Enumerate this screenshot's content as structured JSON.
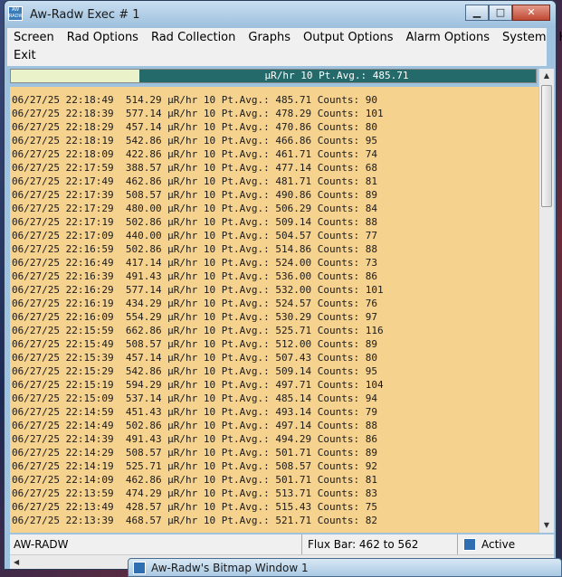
{
  "window": {
    "title": "Aw-Radw Exec # 1",
    "app_icon_text": "AW RADW",
    "buttons": {
      "minimize": "▁",
      "maximize": "□",
      "close": "✕"
    }
  },
  "menu": {
    "row1": [
      "Screen",
      "Rad Options",
      "Rad Collection",
      "Graphs",
      "Output Options",
      "Alarm Options",
      "System",
      "Help"
    ],
    "row2": [
      "Exit"
    ]
  },
  "gauge": {
    "text": "µR/hr 10 Pt.Avg.: 485.71",
    "fill_fraction": 0.755,
    "fill_color": "#246a6a",
    "track_color": "#e9f2c8"
  },
  "log": {
    "background": "#f6d28f",
    "rows": [
      "06/27/25 22:18:49  514.29 µR/hr 10 Pt.Avg.: 485.71 Counts: 90",
      "06/27/25 22:18:39  577.14 µR/hr 10 Pt.Avg.: 478.29 Counts: 101",
      "06/27/25 22:18:29  457.14 µR/hr 10 Pt.Avg.: 470.86 Counts: 80",
      "06/27/25 22:18:19  542.86 µR/hr 10 Pt.Avg.: 466.86 Counts: 95",
      "06/27/25 22:18:09  422.86 µR/hr 10 Pt.Avg.: 461.71 Counts: 74",
      "06/27/25 22:17:59  388.57 µR/hr 10 Pt.Avg.: 477.14 Counts: 68",
      "06/27/25 22:17:49  462.86 µR/hr 10 Pt.Avg.: 481.71 Counts: 81",
      "06/27/25 22:17:39  508.57 µR/hr 10 Pt.Avg.: 490.86 Counts: 89",
      "06/27/25 22:17:29  480.00 µR/hr 10 Pt.Avg.: 506.29 Counts: 84",
      "06/27/25 22:17:19  502.86 µR/hr 10 Pt.Avg.: 509.14 Counts: 88",
      "06/27/25 22:17:09  440.00 µR/hr 10 Pt.Avg.: 504.57 Counts: 77",
      "06/27/25 22:16:59  502.86 µR/hr 10 Pt.Avg.: 514.86 Counts: 88",
      "06/27/25 22:16:49  417.14 µR/hr 10 Pt.Avg.: 524.00 Counts: 73",
      "06/27/25 22:16:39  491.43 µR/hr 10 Pt.Avg.: 536.00 Counts: 86",
      "06/27/25 22:16:29  577.14 µR/hr 10 Pt.Avg.: 532.00 Counts: 101",
      "06/27/25 22:16:19  434.29 µR/hr 10 Pt.Avg.: 524.57 Counts: 76",
      "06/27/25 22:16:09  554.29 µR/hr 10 Pt.Avg.: 530.29 Counts: 97",
      "06/27/25 22:15:59  662.86 µR/hr 10 Pt.Avg.: 525.71 Counts: 116",
      "06/27/25 22:15:49  508.57 µR/hr 10 Pt.Avg.: 512.00 Counts: 89",
      "06/27/25 22:15:39  457.14 µR/hr 10 Pt.Avg.: 507.43 Counts: 80",
      "06/27/25 22:15:29  542.86 µR/hr 10 Pt.Avg.: 509.14 Counts: 95",
      "06/27/25 22:15:19  594.29 µR/hr 10 Pt.Avg.: 497.71 Counts: 104",
      "06/27/25 22:15:09  537.14 µR/hr 10 Pt.Avg.: 485.14 Counts: 94",
      "06/27/25 22:14:59  451.43 µR/hr 10 Pt.Avg.: 493.14 Counts: 79",
      "06/27/25 22:14:49  502.86 µR/hr 10 Pt.Avg.: 497.14 Counts: 88",
      "06/27/25 22:14:39  491.43 µR/hr 10 Pt.Avg.: 494.29 Counts: 86",
      "06/27/25 22:14:29  508.57 µR/hr 10 Pt.Avg.: 501.71 Counts: 89",
      "06/27/25 22:14:19  525.71 µR/hr 10 Pt.Avg.: 508.57 Counts: 92",
      "06/27/25 22:14:09  462.86 µR/hr 10 Pt.Avg.: 501.71 Counts: 81",
      "06/27/25 22:13:59  474.29 µR/hr 10 Pt.Avg.: 513.71 Counts: 83",
      "06/27/25 22:13:49  428.57 µR/hr 10 Pt.Avg.: 515.43 Counts: 75",
      "06/27/25 22:13:39  468.57 µR/hr 10 Pt.Avg.: 521.71 Counts: 82"
    ]
  },
  "statusbar": {
    "left": "AW-RADW",
    "flux": "Flux Bar: 462 to 562",
    "state": "Active",
    "state_icon": "app-icon"
  },
  "scrollbars": {
    "up_arrow": "▲",
    "down_arrow": "▼",
    "left_arrow": "◀"
  },
  "taskbar_window": {
    "title": "Aw-Radw's Bitmap Window 1",
    "icon": "app-icon"
  }
}
